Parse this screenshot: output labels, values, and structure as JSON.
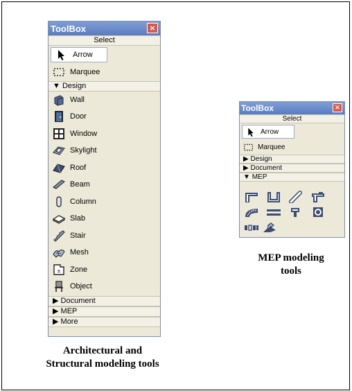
{
  "toolbox_arch": {
    "title": "ToolBox",
    "close_glyph": "×",
    "select_label": "Select",
    "arrow_label": "Arrow",
    "marquee_label": "Marquee",
    "design_label": "Design",
    "tools": [
      {
        "label": "Wall",
        "icon": "wall-icon"
      },
      {
        "label": "Door",
        "icon": "door-icon"
      },
      {
        "label": "Window",
        "icon": "window-icon"
      },
      {
        "label": "Skylight",
        "icon": "skylight-icon"
      },
      {
        "label": "Roof",
        "icon": "roof-icon"
      },
      {
        "label": "Beam",
        "icon": "beam-icon"
      },
      {
        "label": "Column",
        "icon": "column-icon"
      },
      {
        "label": "Slab",
        "icon": "slab-icon"
      },
      {
        "label": "Stair",
        "icon": "stair-icon"
      },
      {
        "label": "Mesh",
        "icon": "mesh-icon"
      },
      {
        "label": "Zone",
        "icon": "zone-icon"
      },
      {
        "label": "Object",
        "icon": "object-icon"
      }
    ],
    "bottom_sections": [
      "Document",
      "MEP",
      "More"
    ]
  },
  "toolbox_mep": {
    "title": "ToolBox",
    "close_glyph": "×",
    "select_label": "Select",
    "arrow_label": "Arrow",
    "marquee_label": "Marquee",
    "sections": [
      "Design",
      "Document",
      "MEP"
    ],
    "mep_tools": [
      "duct-elbow-icon",
      "duct-transition-icon",
      "pipe-icon",
      "duct-tee-icon",
      "flexible-duct-icon",
      "straight-duct-icon",
      "terminal-icon",
      "fan-icon",
      "damper-icon",
      "equipment-icon"
    ]
  },
  "captions": {
    "arch_line1": "Architectural and",
    "arch_line2": "Structural modeling tools",
    "mep_line1": "MEP modeling",
    "mep_line2": "tools"
  },
  "colors": {
    "title_bar": "#6a8bcb",
    "close_button": "#d9574a",
    "panel_background": "#ece9d8"
  }
}
